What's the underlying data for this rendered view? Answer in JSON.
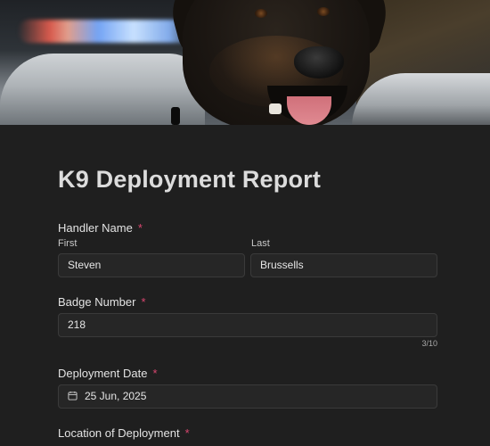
{
  "header": {
    "image_alt": "police dog in front of patrol car"
  },
  "form": {
    "title": "K9 Deployment Report",
    "required_marker": "*",
    "handler_name": {
      "label": "Handler Name",
      "first_label": "First",
      "first_value": "Steven",
      "last_label": "Last",
      "last_value": "Brussells"
    },
    "badge_number": {
      "label": "Badge Number",
      "value": "218",
      "counter": "3/10"
    },
    "deployment_date": {
      "label": "Deployment Date",
      "value": "25 Jun, 2025",
      "icon": "calendar-icon"
    },
    "location": {
      "label": "Location of Deployment"
    }
  },
  "colors": {
    "background": "#1f1f1f",
    "field_bg": "#262626",
    "field_border": "#3a3a3a",
    "required": "#d8466f"
  }
}
